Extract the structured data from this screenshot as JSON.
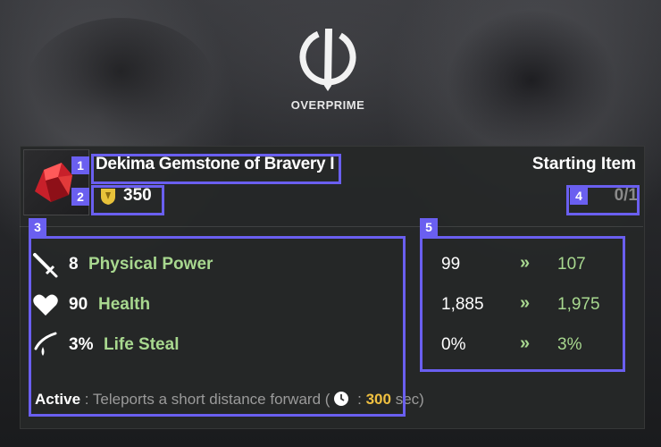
{
  "logo": {
    "text": "OVERPRIME"
  },
  "item": {
    "name": "Dekima Gemstone of Bravery I",
    "price": "350",
    "category": "Starting Item",
    "ownership": "0/1"
  },
  "stats": [
    {
      "icon": "sword-icon",
      "value": "8",
      "name": "Physical Power"
    },
    {
      "icon": "heart-icon",
      "value": "90",
      "name": "Health"
    },
    {
      "icon": "lifesteal-icon",
      "value": "3%",
      "name": "Life Steal"
    }
  ],
  "comparison": [
    {
      "old": "99",
      "arrow": "»",
      "new": "107"
    },
    {
      "old": "1,885",
      "arrow": "»",
      "new": "1,975"
    },
    {
      "old": "0%",
      "arrow": "»",
      "new": "3%"
    }
  ],
  "active": {
    "label": "Active",
    "sep": " : ",
    "desc": "Teleports a short distance forward (",
    "colon": " : ",
    "cooldown": "300",
    "unit": " sec)"
  },
  "badges": [
    "1",
    "2",
    "3",
    "4",
    "5"
  ],
  "colors": {
    "highlight": "#6a5ff0",
    "stat_name": "#a8d88f",
    "cooldown": "#f0c040",
    "panel": "#262828"
  }
}
